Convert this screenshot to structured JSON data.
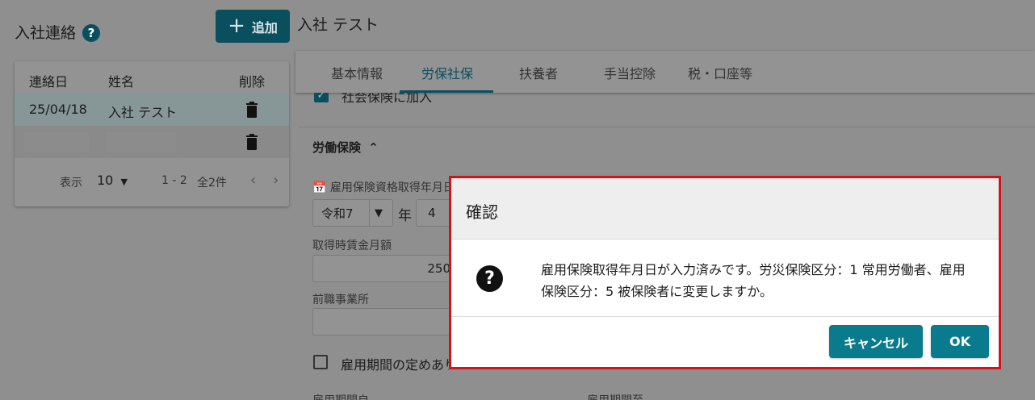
{
  "sidebar": {
    "title": "入社連絡",
    "add_button": "追加",
    "list": {
      "headers": [
        "連絡日",
        "姓名",
        "削除"
      ],
      "rows": [
        {
          "date": "25/04/18",
          "name": "入社 テスト"
        }
      ]
    },
    "pager": {
      "per_page_label": "表示",
      "per_page_value": "10",
      "range": "1 - 2",
      "total": "全2件"
    }
  },
  "main": {
    "employee_name": "入社 テスト",
    "tabs": [
      "基本情報",
      "労保社保",
      "扶養者",
      "手当控除",
      "税・口座等"
    ],
    "active_tab": "労保社保",
    "social_insurance_checkbox": "社会保険に加入",
    "labor_section_title": "労働保険",
    "employment_date_label": "雇用保険資格取得年月日",
    "era_value": "令和7",
    "year_unit": "年",
    "month_value": "4",
    "wage_label": "取得時賃金月額",
    "wage_value": "250",
    "prev_office_label": "前職事業所",
    "fixed_term_checkbox": "雇用期間の定めあり",
    "period_from_label": "雇用期間自",
    "period_to_label": "雇用期間至"
  },
  "dialog": {
    "title": "確認",
    "message": "雇用保険取得年月日が入力済みです。労災保険区分：1 常用労働者、雇用保険区分：5 被保険者に変更しますか。",
    "cancel_label": "キャンセル",
    "ok_label": "OK"
  }
}
